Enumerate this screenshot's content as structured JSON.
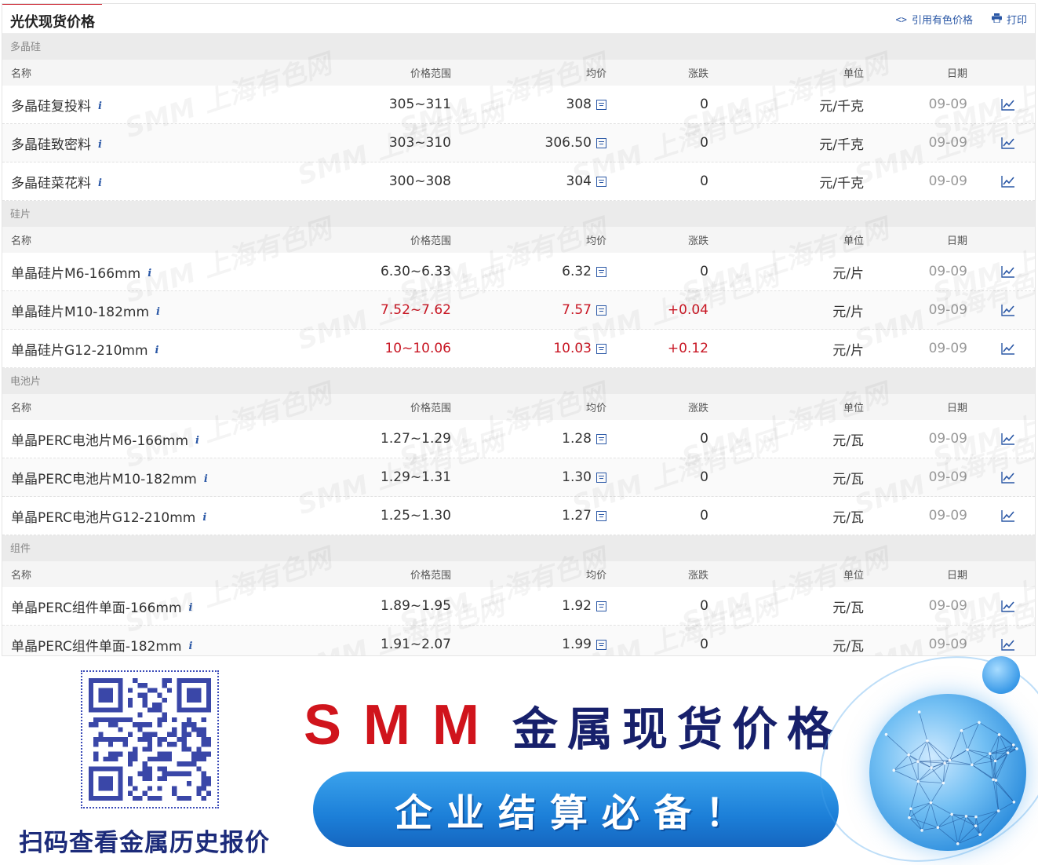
{
  "panel": {
    "title": "光伏现货价格",
    "cite_label": "引用有色价格",
    "print_label": "打印"
  },
  "columns": {
    "name": "名称",
    "range": "价格范围",
    "avg": "均价",
    "change": "涨跌",
    "unit": "单位",
    "date": "日期"
  },
  "watermark": "SMM 上海有色网",
  "sections": [
    {
      "title": "多晶硅",
      "rows": [
        {
          "name": "多晶硅复投料",
          "range": "305~311",
          "avg": "308",
          "change": "0",
          "unit": "元/千克",
          "date": "09-09",
          "up": false
        },
        {
          "name": "多晶硅致密料",
          "range": "303~310",
          "avg": "306.50",
          "change": "0",
          "unit": "元/千克",
          "date": "09-09",
          "up": false
        },
        {
          "name": "多晶硅菜花料",
          "range": "300~308",
          "avg": "304",
          "change": "0",
          "unit": "元/千克",
          "date": "09-09",
          "up": false
        }
      ]
    },
    {
      "title": "硅片",
      "rows": [
        {
          "name": "单晶硅片M6-166mm",
          "range": "6.30~6.33",
          "avg": "6.32",
          "change": "0",
          "unit": "元/片",
          "date": "09-09",
          "up": false
        },
        {
          "name": "单晶硅片M10-182mm",
          "range": "7.52~7.62",
          "avg": "7.57",
          "change": "+0.04",
          "unit": "元/片",
          "date": "09-09",
          "up": true
        },
        {
          "name": "单晶硅片G12-210mm",
          "range": "10~10.06",
          "avg": "10.03",
          "change": "+0.12",
          "unit": "元/片",
          "date": "09-09",
          "up": true
        }
      ]
    },
    {
      "title": "电池片",
      "rows": [
        {
          "name": "单晶PERC电池片M6-166mm",
          "range": "1.27~1.29",
          "avg": "1.28",
          "change": "0",
          "unit": "元/瓦",
          "date": "09-09",
          "up": false
        },
        {
          "name": "单晶PERC电池片M10-182mm",
          "range": "1.29~1.31",
          "avg": "1.30",
          "change": "0",
          "unit": "元/瓦",
          "date": "09-09",
          "up": false
        },
        {
          "name": "单晶PERC电池片G12-210mm",
          "range": "1.25~1.30",
          "avg": "1.27",
          "change": "0",
          "unit": "元/瓦",
          "date": "09-09",
          "up": false
        }
      ]
    },
    {
      "title": "组件",
      "rows": [
        {
          "name": "单晶PERC组件单面-166mm",
          "range": "1.89~1.95",
          "avg": "1.92",
          "change": "0",
          "unit": "元/瓦",
          "date": "09-09",
          "up": false
        },
        {
          "name": "单晶PERC组件单面-182mm",
          "range": "1.91~2.07",
          "avg": "1.99",
          "change": "0",
          "unit": "元/瓦",
          "date": "09-09",
          "up": false
        }
      ]
    }
  ],
  "banner": {
    "brand": "SMM",
    "headline": "金属现货价格",
    "slogan": "企业结算必备！",
    "qr_caption": "扫码查看金属历史报价"
  },
  "colors": {
    "accent_red": "#c81623",
    "link_blue": "#2b58a6",
    "navy": "#17206b"
  }
}
